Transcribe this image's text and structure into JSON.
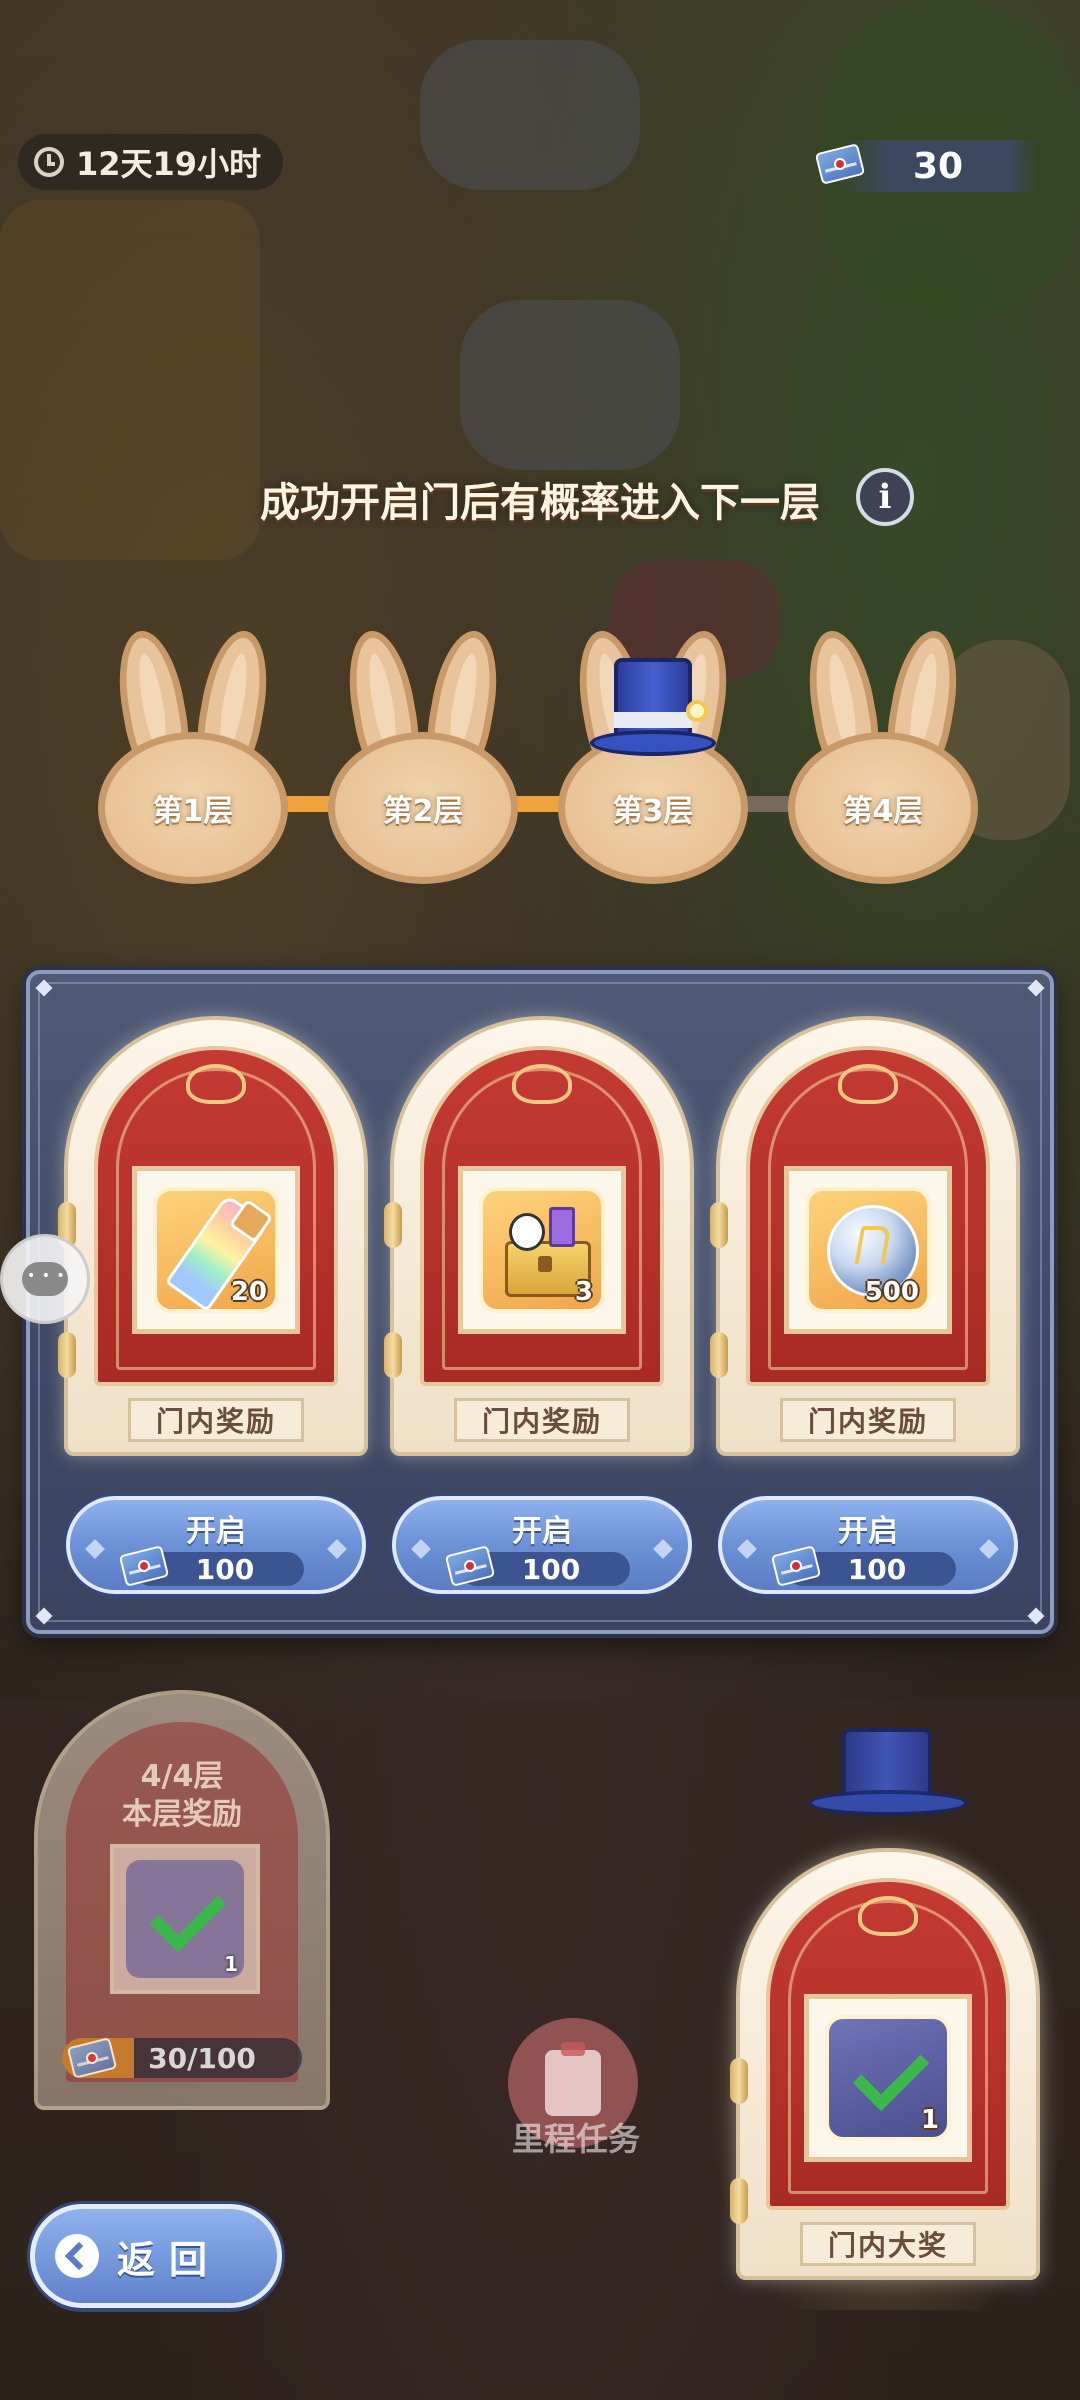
{
  "top_bar": {
    "timer_text": "12天19小时",
    "currency_value": "30"
  },
  "floor_header": {
    "hint": "成功开启门后有概率进入下一层",
    "info_glyph": "i"
  },
  "floors": [
    {
      "label": "第1层"
    },
    {
      "label": "第2层"
    },
    {
      "label": "第3层",
      "current": true
    },
    {
      "label": "第4层"
    }
  ],
  "doors": [
    {
      "reward_label": "门内奖励",
      "quantity": "20",
      "item_icon": "rainbow-paint-tube-icon",
      "open_label": "开启",
      "cost": "100"
    },
    {
      "reward_label": "门内奖励",
      "quantity": "3",
      "item_icon": "music-chest-icon",
      "open_label": "开启",
      "cost": "100"
    },
    {
      "reward_label": "门内奖励",
      "quantity": "500",
      "item_icon": "crystal-orb-icon",
      "open_label": "开启",
      "cost": "100"
    }
  ],
  "floor_reward": {
    "title_line1": "4/4层",
    "title_line2": "本层奖励",
    "item_quantity": "1",
    "progress_text": "30/100",
    "progress_fraction": 0.3
  },
  "milestone": {
    "label": "里程任务"
  },
  "grand_prize": {
    "label": "门内大奖",
    "item_quantity": "1"
  },
  "back_button": {
    "label": "返回"
  },
  "colors": {
    "panel_bg": "#434d6a",
    "button_blue": "#6e93d8",
    "door_red": "#b8312c",
    "floor_connector_active": "#f0a23c",
    "check_green": "#3bb84a"
  }
}
